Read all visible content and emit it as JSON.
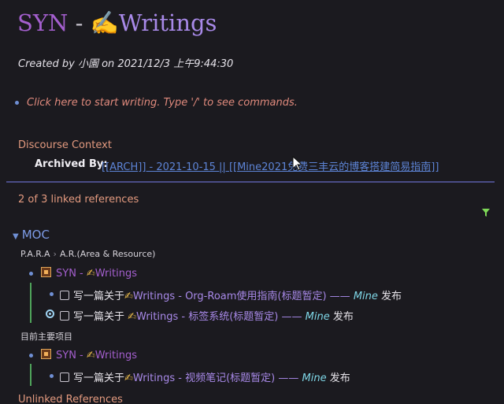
{
  "page": {
    "title_syn": "SYN",
    "title_dash": " - ",
    "title_hand": "✍",
    "title_writings": "Writings",
    "created_by": "Created by 小園 on 2021/12/3 上午9:44:30",
    "placeholder": "Click here to start writing. Type '/' to see commands."
  },
  "discourse": {
    "title": "Discourse Context",
    "archived_label": "Archived By:",
    "archived_link": "[[ARCH]] - 2021-10-15 || [[Mine2021免费三丰云的博客搭建简易指南]]"
  },
  "linked": {
    "count_label": "2 of 3 linked references",
    "group_caret": "▼",
    "group_title": "MOC",
    "crumb_1": "P.A.R.A",
    "crumb_sep": "›",
    "crumb_2": "A.R.(Area & Resource)",
    "syn_prefix": "SYN - ",
    "syn_hand": "✍",
    "syn_writings": "Writings",
    "task1_pre": "写一篇关于",
    "task1_hand": "✍",
    "task1_mid": "Writings - Org-Roam使用指南(标题暂定) —— ",
    "task1_mine": "Mine",
    "task1_post": " 发布",
    "task2_pre": "写一篇关于 ",
    "task2_hand": "✍",
    "task2_mid": "Writings - 标签系统(标题暂定) —— ",
    "task2_mine": "Mine",
    "task2_post": " 发布",
    "group2_label": "目前主要项目",
    "task3_pre": "写一篇关于",
    "task3_hand": "✍",
    "task3_mid": "Writings - 视频笔记(标题暂定) —— ",
    "task3_mine": "Mine",
    "task3_post": " 发布"
  },
  "unlinked": {
    "title": "Unlinked References"
  },
  "icons": {
    "filter": "filter-icon",
    "cursor": "mouse-pointer-icon",
    "caret": "caret-down-icon",
    "block": "block-ref-icon"
  },
  "colors": {
    "background": "#1b1a1f",
    "accent_purple": "#a45fce",
    "link_blue": "#5d84d6",
    "section_orange": "#e39a7f",
    "divider": "#4a4d86",
    "tag_cyan": "#7fd8e8",
    "thread_green": "#4fa35a"
  }
}
